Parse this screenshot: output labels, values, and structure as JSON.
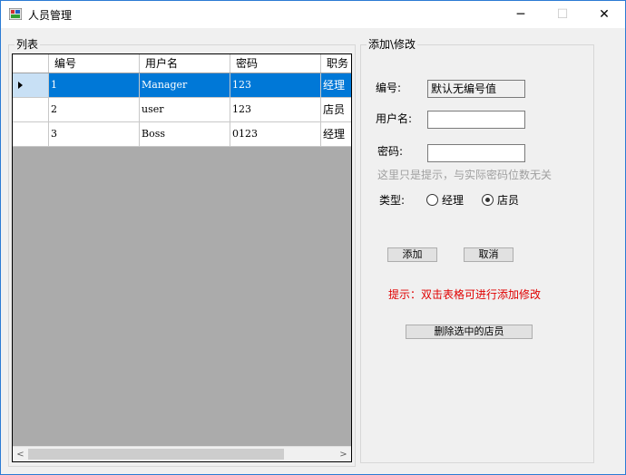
{
  "window": {
    "title": "人员管理",
    "controls": [
      "─",
      "☐",
      "✕"
    ]
  },
  "list_group": {
    "title": "列表",
    "columns": [
      "编号",
      "用户名",
      "密码",
      "职务"
    ],
    "rows": [
      {
        "id": "1",
        "username": "Manager",
        "password": "123",
        "role": "经理",
        "selected": true
      },
      {
        "id": "2",
        "username": "user",
        "password": "123",
        "role": "店员",
        "selected": false
      },
      {
        "id": "3",
        "username": "Boss",
        "password": "0123",
        "role": "经理",
        "selected": false
      }
    ],
    "scroll_left": "<",
    "scroll_right": ">"
  },
  "edit_group": {
    "title": "添加\\修改",
    "id_label": "编号:",
    "id_value": "默认无编号值",
    "username_label": "用户名:",
    "username_value": "",
    "password_label": "密码:",
    "password_value": "",
    "password_hint": "这里只是提示，与实际密码位数无关",
    "type_label": "类型:",
    "type_options": [
      "经理",
      "店员"
    ],
    "type_selected": "店员",
    "add_button": "添加",
    "cancel_button": "取消",
    "tip": "提示：双击表格可进行添加修改",
    "delete_button": "删除选中的店员"
  },
  "colors": {
    "selection": "#0078d7",
    "tip": "#e00000",
    "hint": "#a0a0a0"
  }
}
